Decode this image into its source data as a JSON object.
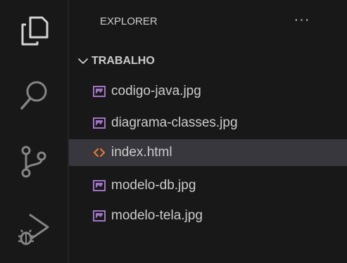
{
  "explorer": {
    "title": "EXPLORER",
    "more_label": "···"
  },
  "workspace": {
    "folder_name": "TRABALHO",
    "expanded": true
  },
  "files": [
    {
      "name": "codigo-java.jpg",
      "icon": "image-file-icon",
      "selected": false
    },
    {
      "name": "diagrama-classes.jpg",
      "icon": "image-file-icon",
      "selected": false
    },
    {
      "name": "index.html",
      "icon": "html-file-icon",
      "selected": true
    },
    {
      "name": "modelo-db.jpg",
      "icon": "image-file-icon",
      "selected": false
    },
    {
      "name": "modelo-tela.jpg",
      "icon": "image-file-icon",
      "selected": false
    }
  ],
  "activity_bar": [
    {
      "name": "explorer",
      "icon": "files-icon",
      "active": true
    },
    {
      "name": "search",
      "icon": "search-icon",
      "active": false
    },
    {
      "name": "source-control",
      "icon": "source-control-icon",
      "active": false
    },
    {
      "name": "run-and-debug",
      "icon": "run-debug-icon",
      "active": false
    }
  ],
  "colors": {
    "background": "#181818",
    "selected_row": "#37373d",
    "text": "#cccccc",
    "image_icon": "#a074c4",
    "html_icon": "#e37933"
  }
}
